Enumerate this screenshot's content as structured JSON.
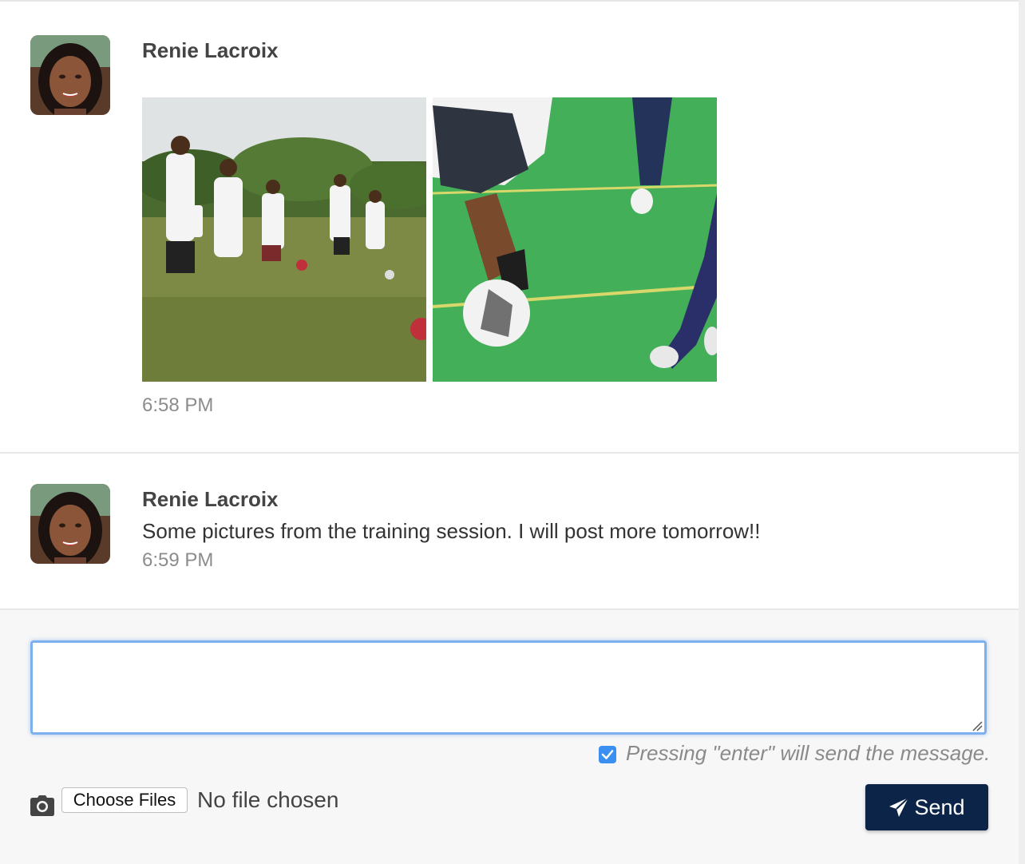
{
  "messages": [
    {
      "author": "Renie Lacroix",
      "text": "",
      "time": "6:58 PM",
      "attachments": [
        {
          "alt": "photo-training-field-players"
        },
        {
          "alt": "photo-soccer-ball-closeup"
        }
      ]
    },
    {
      "author": "Renie Lacroix",
      "text": "Some pictures from the training session. I will post more tomorrow!!",
      "time": "6:59 PM"
    }
  ],
  "composer": {
    "input_value": "",
    "enter_label": "Pressing \"enter\" will send the message.",
    "enter_checked": true,
    "choose_files_label": "Choose Files",
    "no_file_label": "No file chosen",
    "send_label": "Send"
  },
  "colors": {
    "send_button": "#0b2447",
    "input_focus": "#7fb0ee",
    "checkbox": "#3b8ff0"
  },
  "icons": [
    "camera-icon",
    "paper-plane-icon",
    "checkmark-icon",
    "resize-grip-icon"
  ]
}
